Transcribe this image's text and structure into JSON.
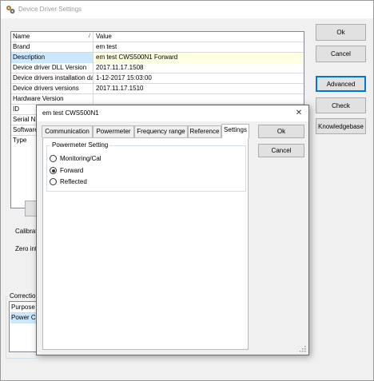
{
  "main_window": {
    "title": "Device Driver Settings",
    "buttons": {
      "ok": "Ok",
      "cancel": "Cancel",
      "advanced": "Advanced",
      "check": "Check",
      "knowledgebase": "Knowledgebase"
    }
  },
  "property_grid": {
    "columns": [
      "Name",
      "Value"
    ],
    "rows": [
      {
        "name": "Brand",
        "value": "em test"
      },
      {
        "name": "Description",
        "value": "em test CWS500N1 Forward"
      },
      {
        "name": "Device driver DLL Version",
        "value": "2017.11.17.1508"
      },
      {
        "name": "Device drivers installation date",
        "value": "1-12-2017 15:03:00"
      },
      {
        "name": "Device drivers versions",
        "value": "2017.11.17.1510"
      },
      {
        "name": "Hardware Version",
        "value": ""
      },
      {
        "name": "ID",
        "value": ""
      },
      {
        "name": "Serial Nu",
        "value": ""
      },
      {
        "name": "Software",
        "value": ""
      },
      {
        "name": "Type",
        "value": ""
      }
    ]
  },
  "side_labels": {
    "calibration": "Calibratio",
    "zero": "Zero inte"
  },
  "corrections": {
    "title": "Correction",
    "column": "Purpose",
    "row": "Power Cor"
  },
  "dialog": {
    "title": "em test CWS500N1",
    "close_glyph": "✕",
    "tabs": [
      "Communication",
      "Powermeter",
      "Frequency range",
      "Reference",
      "Settings"
    ],
    "ok": "Ok",
    "cancel": "Cancel",
    "group_title": "Powermeter Setting",
    "options": [
      {
        "label": "Monitoring/Cal",
        "checked": false
      },
      {
        "label": "Forward",
        "checked": true
      },
      {
        "label": "Reflected",
        "checked": false
      }
    ]
  },
  "colors": {
    "selection": "#cce8ff",
    "highlight_value": "#ffffe1",
    "accent": "#0078d7"
  }
}
